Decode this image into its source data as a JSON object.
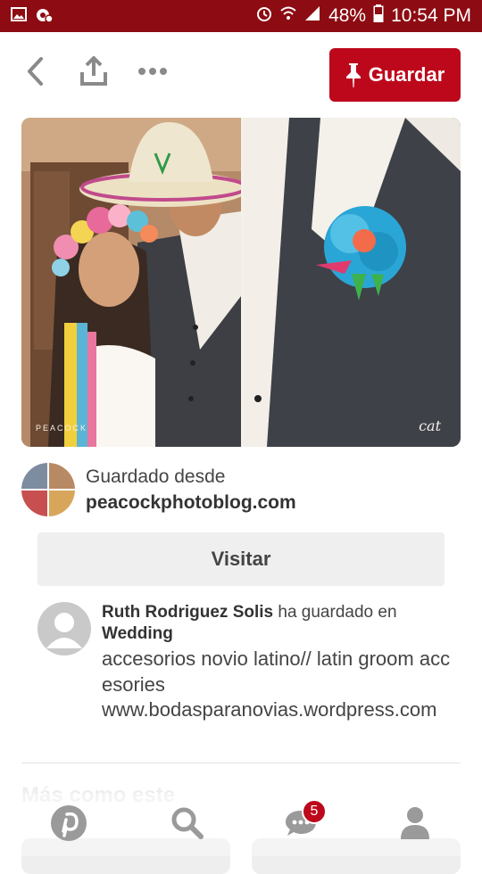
{
  "statusbar": {
    "battery": "48%",
    "time": "10:54 PM"
  },
  "toolbar": {
    "save_label": "Guardar"
  },
  "pin": {
    "watermark_left": "PEACOCK",
    "watermark_right": "cat"
  },
  "source": {
    "saved_from": "Guardado desde",
    "domain": "peacockphotoblog.com"
  },
  "visit": {
    "label": "Visitar"
  },
  "saver": {
    "name": "Ruth Rodriguez Solis",
    "action": " ha guardado en",
    "board": "Wedding",
    "description_1": "accesorios novio latino// latin groom accesories",
    "description_2": "www.bodasparanovias.wordpress.com"
  },
  "more": {
    "title": "Más como este"
  },
  "nav": {
    "notifications_count": "5"
  },
  "colors": {
    "brand": "#bd081c",
    "statusbar": "#8d0b12"
  }
}
